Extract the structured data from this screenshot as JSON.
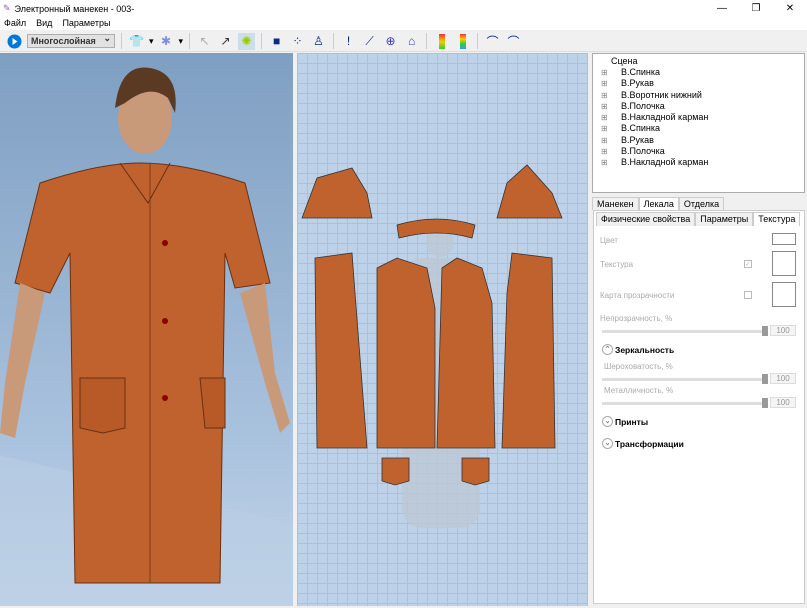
{
  "window": {
    "title": "Электронный манекен - 003-",
    "minimize": "—",
    "maximize": "❐",
    "close": "✕"
  },
  "menu": [
    "Файл",
    "Вид",
    "Параметры"
  ],
  "toolbar": {
    "mode_select": "Многослойная",
    "icons": [
      "play-icon",
      "shirt-icon",
      "mannequin-icon",
      "pointer-icon",
      "arrow-icon",
      "gear-icon",
      "tshirt-icon",
      "points-icon",
      "measure-figure-icon",
      "pin-icon",
      "line-icon",
      "button-icon",
      "bell-icon",
      "color-gradient-icon",
      "texture-gradient-icon",
      "curve-icon",
      "curve2-icon"
    ]
  },
  "colors": {
    "fabric": "#c0622e",
    "accent": "#0078d7"
  },
  "tree": {
    "root": "Сцена",
    "items": [
      "В.Спинка",
      "В.Рукав",
      "В.Воротник нижний",
      "В.Полочка",
      "В.Накладной карман",
      "В.Спинка",
      "В.Рукав",
      "В.Полочка",
      "В.Накладной карман"
    ]
  },
  "tabs": [
    "Манекен",
    "Лекала",
    "Отделка"
  ],
  "subtabs": [
    "Физические свойства",
    "Параметры",
    "Текстура"
  ],
  "texture": {
    "color_label": "Цвет",
    "texture_label": "Текстура",
    "texture_checked": true,
    "alpha_map_label": "Карта прозрачности",
    "alpha_map_checked": false,
    "opacity_label": "Непрозрачность, %",
    "opacity_value": "100",
    "specular_section": "Зеркальность",
    "roughness_label": "Шероховатость, %",
    "roughness_value": "100",
    "metallic_label": "Металличность, %",
    "metallic_value": "100",
    "prints_section": "Принты",
    "transforms_section": "Трансформации"
  }
}
